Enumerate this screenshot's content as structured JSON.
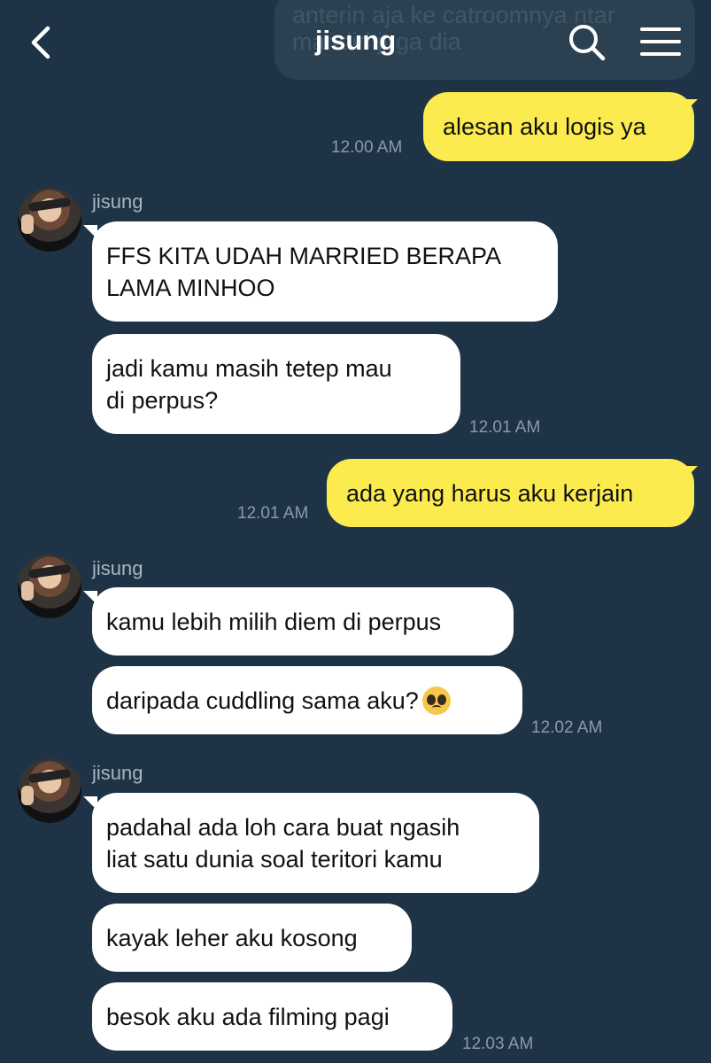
{
  "header": {
    "title": "jisung",
    "ghost_text": "anterin aja ke catroomnya ntar\nmandiri juga dia",
    "back_icon": "chevron-left-icon",
    "search_icon": "search-icon",
    "menu_icon": "hamburger-menu-icon"
  },
  "colors": {
    "background": "#1f3346",
    "sent_bubble": "#fbeb4f",
    "received_bubble": "#ffffff"
  },
  "messages": [
    {
      "text": "alesan aku logis ya",
      "time": "12.00 AM"
    },
    {
      "sender": "jisung",
      "text": "FFS KITA UDAH MARRIED BERAPA\nLAMA MINHOO"
    },
    {
      "text": "jadi kamu masih tetep mau\ndi perpus?",
      "time": "12.01 AM"
    },
    {
      "text": "ada yang harus aku kerjain",
      "time": "12.01 AM"
    },
    {
      "sender": "jisung",
      "text": "kamu lebih milih diem di perpus"
    },
    {
      "text": "daripada cuddling sama aku?",
      "emoji": "pleading-face-emoji",
      "time": "12.02 AM"
    },
    {
      "sender": "jisung",
      "text": "padahal ada loh cara buat ngasih\nliat satu dunia soal teritori kamu"
    },
    {
      "text": "kayak leher aku kosong"
    },
    {
      "text": "besok aku ada filming pagi",
      "time": "12.03 AM"
    }
  ]
}
